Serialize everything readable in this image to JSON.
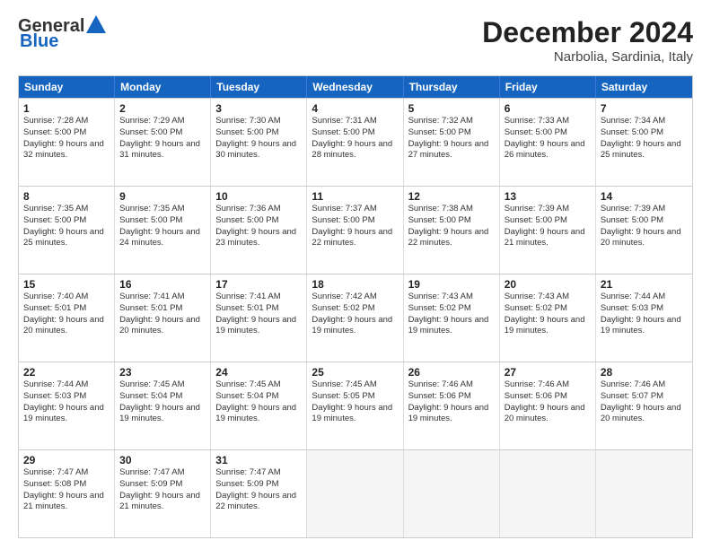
{
  "header": {
    "logo_general": "General",
    "logo_blue": "Blue",
    "title": "December 2024",
    "subtitle": "Narbolia, Sardinia, Italy"
  },
  "calendar": {
    "days_of_week": [
      "Sunday",
      "Monday",
      "Tuesday",
      "Wednesday",
      "Thursday",
      "Friday",
      "Saturday"
    ],
    "weeks": [
      [
        {
          "day": "",
          "info": "",
          "empty": true
        },
        {
          "day": "",
          "info": "",
          "empty": true
        },
        {
          "day": "",
          "info": "",
          "empty": true
        },
        {
          "day": "",
          "info": "",
          "empty": true
        },
        {
          "day": "",
          "info": "",
          "empty": true
        },
        {
          "day": "",
          "info": "",
          "empty": true
        },
        {
          "day": "",
          "info": "",
          "empty": true
        }
      ],
      [
        {
          "day": "1",
          "info": "Sunrise: 7:28 AM\nSunset: 5:00 PM\nDaylight: 9 hours and 32 minutes."
        },
        {
          "day": "2",
          "info": "Sunrise: 7:29 AM\nSunset: 5:00 PM\nDaylight: 9 hours and 31 minutes."
        },
        {
          "day": "3",
          "info": "Sunrise: 7:30 AM\nSunset: 5:00 PM\nDaylight: 9 hours and 30 minutes."
        },
        {
          "day": "4",
          "info": "Sunrise: 7:31 AM\nSunset: 5:00 PM\nDaylight: 9 hours and 28 minutes."
        },
        {
          "day": "5",
          "info": "Sunrise: 7:32 AM\nSunset: 5:00 PM\nDaylight: 9 hours and 27 minutes."
        },
        {
          "day": "6",
          "info": "Sunrise: 7:33 AM\nSunset: 5:00 PM\nDaylight: 9 hours and 26 minutes."
        },
        {
          "day": "7",
          "info": "Sunrise: 7:34 AM\nSunset: 5:00 PM\nDaylight: 9 hours and 25 minutes."
        }
      ],
      [
        {
          "day": "8",
          "info": "Sunrise: 7:35 AM\nSunset: 5:00 PM\nDaylight: 9 hours and 25 minutes."
        },
        {
          "day": "9",
          "info": "Sunrise: 7:35 AM\nSunset: 5:00 PM\nDaylight: 9 hours and 24 minutes."
        },
        {
          "day": "10",
          "info": "Sunrise: 7:36 AM\nSunset: 5:00 PM\nDaylight: 9 hours and 23 minutes."
        },
        {
          "day": "11",
          "info": "Sunrise: 7:37 AM\nSunset: 5:00 PM\nDaylight: 9 hours and 22 minutes."
        },
        {
          "day": "12",
          "info": "Sunrise: 7:38 AM\nSunset: 5:00 PM\nDaylight: 9 hours and 22 minutes."
        },
        {
          "day": "13",
          "info": "Sunrise: 7:39 AM\nSunset: 5:00 PM\nDaylight: 9 hours and 21 minutes."
        },
        {
          "day": "14",
          "info": "Sunrise: 7:39 AM\nSunset: 5:00 PM\nDaylight: 9 hours and 20 minutes."
        }
      ],
      [
        {
          "day": "15",
          "info": "Sunrise: 7:40 AM\nSunset: 5:01 PM\nDaylight: 9 hours and 20 minutes."
        },
        {
          "day": "16",
          "info": "Sunrise: 7:41 AM\nSunset: 5:01 PM\nDaylight: 9 hours and 20 minutes."
        },
        {
          "day": "17",
          "info": "Sunrise: 7:41 AM\nSunset: 5:01 PM\nDaylight: 9 hours and 19 minutes."
        },
        {
          "day": "18",
          "info": "Sunrise: 7:42 AM\nSunset: 5:02 PM\nDaylight: 9 hours and 19 minutes."
        },
        {
          "day": "19",
          "info": "Sunrise: 7:43 AM\nSunset: 5:02 PM\nDaylight: 9 hours and 19 minutes."
        },
        {
          "day": "20",
          "info": "Sunrise: 7:43 AM\nSunset: 5:02 PM\nDaylight: 9 hours and 19 minutes."
        },
        {
          "day": "21",
          "info": "Sunrise: 7:44 AM\nSunset: 5:03 PM\nDaylight: 9 hours and 19 minutes."
        }
      ],
      [
        {
          "day": "22",
          "info": "Sunrise: 7:44 AM\nSunset: 5:03 PM\nDaylight: 9 hours and 19 minutes."
        },
        {
          "day": "23",
          "info": "Sunrise: 7:45 AM\nSunset: 5:04 PM\nDaylight: 9 hours and 19 minutes."
        },
        {
          "day": "24",
          "info": "Sunrise: 7:45 AM\nSunset: 5:04 PM\nDaylight: 9 hours and 19 minutes."
        },
        {
          "day": "25",
          "info": "Sunrise: 7:45 AM\nSunset: 5:05 PM\nDaylight: 9 hours and 19 minutes."
        },
        {
          "day": "26",
          "info": "Sunrise: 7:46 AM\nSunset: 5:06 PM\nDaylight: 9 hours and 19 minutes."
        },
        {
          "day": "27",
          "info": "Sunrise: 7:46 AM\nSunset: 5:06 PM\nDaylight: 9 hours and 20 minutes."
        },
        {
          "day": "28",
          "info": "Sunrise: 7:46 AM\nSunset: 5:07 PM\nDaylight: 9 hours and 20 minutes."
        }
      ],
      [
        {
          "day": "29",
          "info": "Sunrise: 7:47 AM\nSunset: 5:08 PM\nDaylight: 9 hours and 21 minutes."
        },
        {
          "day": "30",
          "info": "Sunrise: 7:47 AM\nSunset: 5:09 PM\nDaylight: 9 hours and 21 minutes."
        },
        {
          "day": "31",
          "info": "Sunrise: 7:47 AM\nSunset: 5:09 PM\nDaylight: 9 hours and 22 minutes."
        },
        {
          "day": "",
          "info": "",
          "empty": true
        },
        {
          "day": "",
          "info": "",
          "empty": true
        },
        {
          "day": "",
          "info": "",
          "empty": true
        },
        {
          "day": "",
          "info": "",
          "empty": true
        }
      ]
    ]
  }
}
